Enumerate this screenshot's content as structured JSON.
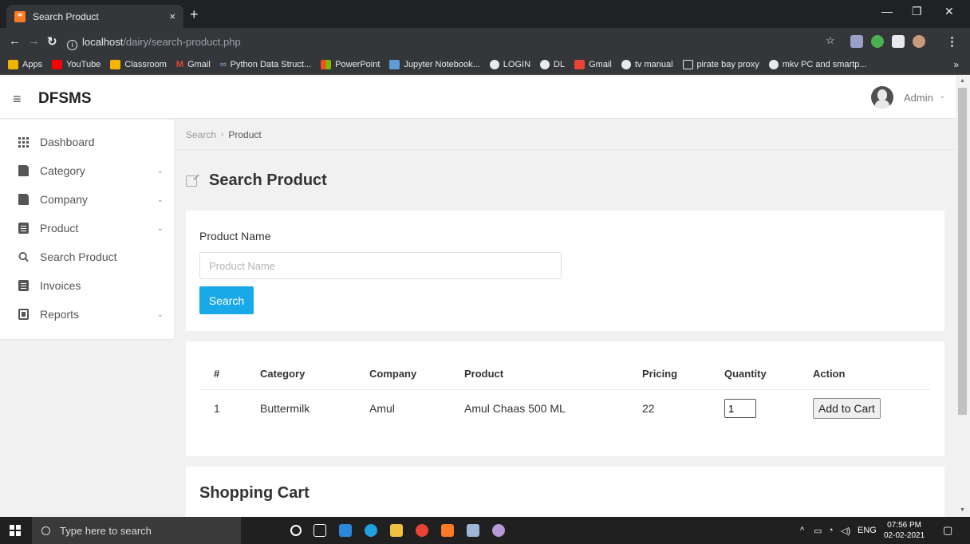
{
  "browser": {
    "tab_title": "Search Product",
    "tab_close": "×",
    "new_tab": "+",
    "url_host": "localhost",
    "url_path": "/dairy/search-product.php",
    "bookmarks": [
      "Apps",
      "YouTube",
      "Classroom",
      "Gmail",
      "Python Data Struct...",
      "PowerPoint",
      "Jupyter Notebook...",
      "LOGIN",
      "DL",
      "Gmail",
      "tv manual",
      "pirate bay proxy",
      "mkv PC and smartp..."
    ],
    "bookmarks_more": "»"
  },
  "header": {
    "brand": "DFSMS",
    "user": "Admin"
  },
  "sidebar": {
    "items": [
      {
        "label": "Dashboard",
        "icon": "grid-icon"
      },
      {
        "label": "Category",
        "icon": "document-icon"
      },
      {
        "label": "Company",
        "icon": "document-icon"
      },
      {
        "label": "Product",
        "icon": "list-icon"
      },
      {
        "label": "Search Product",
        "icon": "search-icon"
      },
      {
        "label": "Invoices",
        "icon": "list-icon"
      },
      {
        "label": "Reports",
        "icon": "report-icon"
      }
    ]
  },
  "breadcrumb": {
    "parent": "Search",
    "current": "Product"
  },
  "page": {
    "title": "Search Product"
  },
  "search_form": {
    "label": "Product Name",
    "placeholder": "Product Name",
    "value": "",
    "button": "Search"
  },
  "results": {
    "headers": [
      "#",
      "Category",
      "Company",
      "Product",
      "Pricing",
      "Quantity",
      "Action"
    ],
    "rows": [
      {
        "num": "1",
        "category": "Buttermilk",
        "company": "Amul",
        "product": "Amul Chaas 500 ML",
        "pricing": "22",
        "quantity": "1",
        "action": "Add to Cart"
      }
    ]
  },
  "cart": {
    "title": "Shopping Cart"
  },
  "taskbar": {
    "search_placeholder": "Type here to search",
    "language": "ENG",
    "time": "07:56 PM",
    "date": "02-02-2021"
  },
  "colors": {
    "accent": "#19a9e8",
    "chrome_dark": "#202124",
    "chrome_mid": "#35363a"
  }
}
